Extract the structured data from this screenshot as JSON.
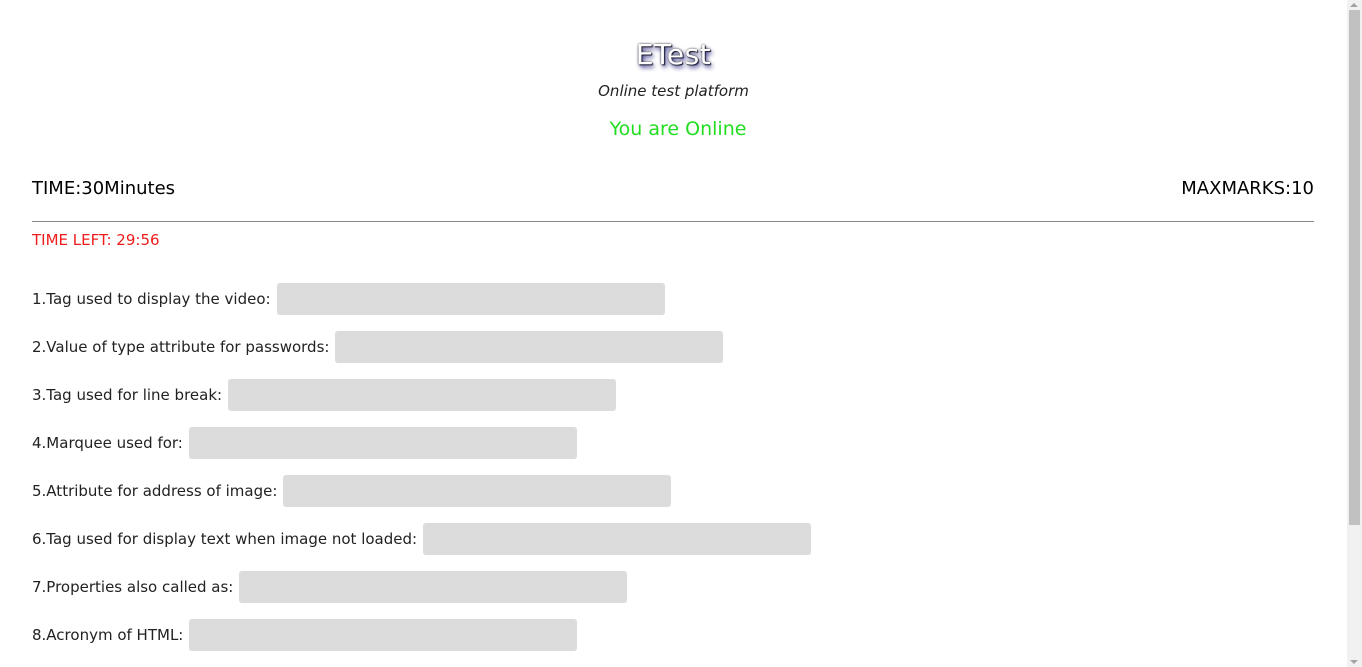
{
  "header": {
    "brand": "ETest",
    "tagline": "Online test platform",
    "status": "You are Online"
  },
  "exam": {
    "time": "TIME:30Minutes",
    "max_marks": "MAXMARKS:10",
    "time_left": "TIME LEFT: 29:56"
  },
  "questions": [
    {
      "label": "1.Tag used to display the video:",
      "value": ""
    },
    {
      "label": "2.Value of type attribute for passwords:",
      "value": ""
    },
    {
      "label": "3.Tag used for line break:",
      "value": ""
    },
    {
      "label": "4.Marquee used for:",
      "value": ""
    },
    {
      "label": "5.Attribute for address of image:",
      "value": ""
    },
    {
      "label": "6.Tag used for display text when image not loaded:",
      "value": ""
    },
    {
      "label": "7.Properties also called as:",
      "value": ""
    },
    {
      "label": "8.Acronym of HTML:",
      "value": ""
    }
  ],
  "colors": {
    "status_online": "#22dd22",
    "time_left": "#ee1c1c",
    "input_background": "#dcdcdc"
  }
}
